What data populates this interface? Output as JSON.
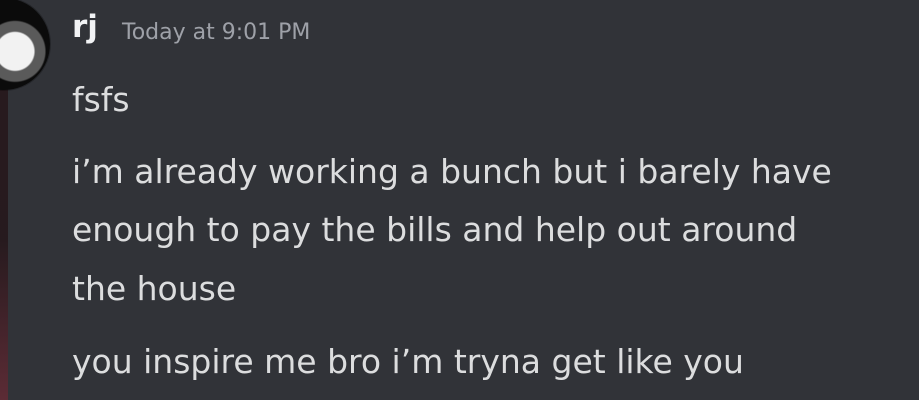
{
  "message": {
    "author": "rj",
    "timestamp": "Today at 9:01 PM",
    "avatar_icon": "avatar-icon",
    "lines": [
      "fsfs",
      "i’m already working a bunch but i barely have",
      "enough to pay the bills and help out around",
      "the house",
      "you inspire me bro i’m tryna get like you"
    ]
  }
}
